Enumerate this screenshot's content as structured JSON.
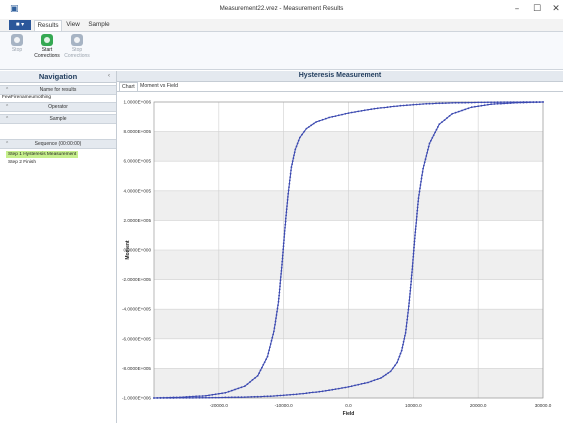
{
  "window": {
    "title": "Measurement22.vrez - Measurement Results",
    "minimize": "–",
    "maximize": "☐",
    "close": "✕"
  },
  "ribbon": {
    "file_tab": "■ ▾",
    "tabs": [
      {
        "label": "Results",
        "active": true
      },
      {
        "label": "View",
        "active": false
      },
      {
        "label": "Sample",
        "active": false
      }
    ],
    "buttons": [
      {
        "line1": "Stop",
        "line2": "",
        "enabled": false
      },
      {
        "line1": "Start",
        "line2": "Corrections",
        "enabled": true
      },
      {
        "line1": "Stop",
        "line2": "Corrections",
        "enabled": false
      }
    ]
  },
  "navigation": {
    "title": "Navigation",
    "collapse_glyph": "‹",
    "name_section": "Name for results",
    "name_value": "FewFirenameumothing",
    "operator_section": "Operator",
    "sample_section": "Sample",
    "sequence_section": "Sequence (00:00:00)",
    "steps": [
      {
        "label": "Step 1 Hysteresis Measurement",
        "active": true
      },
      {
        "label": "Step 2 Finish",
        "active": false
      }
    ]
  },
  "main": {
    "title": "Hysteresis Measurement",
    "tabs": [
      {
        "label": "Chart",
        "active": true
      },
      {
        "label": "Moment vs Field",
        "active": false
      }
    ]
  },
  "chart_data": {
    "type": "line",
    "xlabel": "Field",
    "ylabel": "Moment",
    "xlim": [
      -30000,
      30000
    ],
    "ylim": [
      -1000000,
      1000000
    ],
    "x_ticks": [
      "-20000.0",
      "-10000.0",
      "0.0",
      "10000.0",
      "20000.0",
      "30000.0"
    ],
    "y_ticks": [
      "1.0000E+006",
      "8.0000E+005",
      "6.0000E+005",
      "4.0000E+005",
      "2.0000E+005",
      "0.0000E+000",
      "-2.0000E+005",
      "-4.0000E+005",
      "-6.0000E+005",
      "-8.0000E+005",
      "-1.0000E+006"
    ],
    "grid": true,
    "color": "#3b49b0",
    "series": [
      {
        "x": [
          -30000,
          -26000,
          -22000,
          -19000,
          -16000,
          -14000,
          -12500,
          -11500,
          -10800,
          -10300,
          -9800,
          -9300,
          -8800,
          -8200,
          -7500,
          -6500,
          -5000,
          -3000,
          0,
          4000,
          8000,
          12000,
          16000,
          20000,
          24000,
          28000,
          30000
        ],
        "y": [
          -1000000,
          -995000,
          -985000,
          -965000,
          -920000,
          -850000,
          -720000,
          -550000,
          -350000,
          -120000,
          150000,
          380000,
          560000,
          680000,
          760000,
          820000,
          865000,
          895000,
          925000,
          955000,
          975000,
          988000,
          994000,
          997000,
          999000,
          1000000,
          1000000
        ]
      },
      {
        "x": [
          30000,
          26000,
          22000,
          19000,
          16000,
          14000,
          12500,
          11500,
          10800,
          10300,
          9800,
          9300,
          8800,
          8200,
          7500,
          6500,
          5000,
          3000,
          0,
          -4000,
          -8000,
          -12000,
          -16000,
          -20000,
          -24000,
          -28000,
          -30000
        ],
        "y": [
          1000000,
          995000,
          985000,
          965000,
          920000,
          850000,
          720000,
          550000,
          350000,
          120000,
          -150000,
          -380000,
          -560000,
          -680000,
          -760000,
          -820000,
          -865000,
          -895000,
          -925000,
          -955000,
          -975000,
          -988000,
          -994000,
          -997000,
          -999000,
          -1000000,
          -1000000
        ]
      }
    ]
  }
}
